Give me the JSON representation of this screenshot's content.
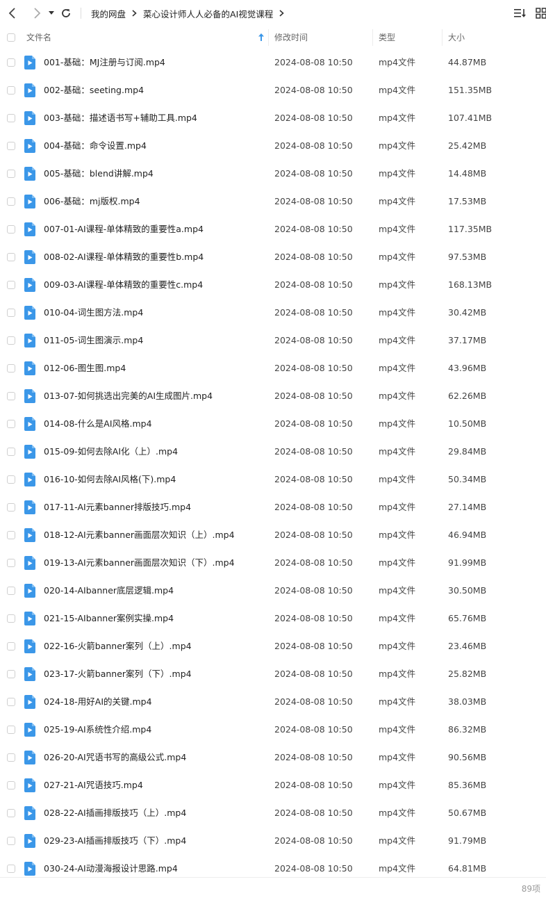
{
  "toolbar": {
    "back_icon": "chevron-left-icon",
    "forward_icon": "chevron-right-icon",
    "history_icon": "caret-down-icon",
    "refresh_icon": "refresh-icon",
    "breadcrumb": [
      "我的网盘",
      "菜心设计师人人必备的AI视觉课程"
    ],
    "sort_icon": "sort-list-icon",
    "grid_icon": "grid-view-icon"
  },
  "table": {
    "headers": {
      "name": "文件名",
      "time": "修改时间",
      "type": "类型",
      "size": "大小"
    },
    "sort_icon": "sort-up-arrow-icon",
    "rows": [
      {
        "name": "001-基础：MJ注册与订阅.mp4",
        "time": "2024-08-08 10:50",
        "type": "mp4文件",
        "size": "44.87MB"
      },
      {
        "name": "002-基础：seeting.mp4",
        "time": "2024-08-08 10:50",
        "type": "mp4文件",
        "size": "151.35MB"
      },
      {
        "name": "003-基础：描述语书写+辅助工具.mp4",
        "time": "2024-08-08 10:50",
        "type": "mp4文件",
        "size": "107.41MB"
      },
      {
        "name": "004-基础：命令设置.mp4",
        "time": "2024-08-08 10:50",
        "type": "mp4文件",
        "size": "25.42MB"
      },
      {
        "name": "005-基础：blend讲解.mp4",
        "time": "2024-08-08 10:50",
        "type": "mp4文件",
        "size": "14.48MB"
      },
      {
        "name": "006-基础：mj版权.mp4",
        "time": "2024-08-08 10:50",
        "type": "mp4文件",
        "size": "17.53MB"
      },
      {
        "name": "007-01-AI课程-单体精致的重要性a.mp4",
        "time": "2024-08-08 10:50",
        "type": "mp4文件",
        "size": "117.35MB"
      },
      {
        "name": "008-02-AI课程-单体精致的重要性b.mp4",
        "time": "2024-08-08 10:50",
        "type": "mp4文件",
        "size": "97.53MB"
      },
      {
        "name": "009-03-AI课程-单体精致的重要性c.mp4",
        "time": "2024-08-08 10:50",
        "type": "mp4文件",
        "size": "168.13MB"
      },
      {
        "name": "010-04-词生图方法.mp4",
        "time": "2024-08-08 10:50",
        "type": "mp4文件",
        "size": "30.42MB"
      },
      {
        "name": "011-05-词生图演示.mp4",
        "time": "2024-08-08 10:50",
        "type": "mp4文件",
        "size": "37.17MB"
      },
      {
        "name": "012-06-图生图.mp4",
        "time": "2024-08-08 10:50",
        "type": "mp4文件",
        "size": "43.96MB"
      },
      {
        "name": "013-07-如何挑选出完美的AI生成图片.mp4",
        "time": "2024-08-08 10:50",
        "type": "mp4文件",
        "size": "62.26MB"
      },
      {
        "name": "014-08-什么是AI风格.mp4",
        "time": "2024-08-08 10:50",
        "type": "mp4文件",
        "size": "10.50MB"
      },
      {
        "name": "015-09-如何去除AI化（上）.mp4",
        "time": "2024-08-08 10:50",
        "type": "mp4文件",
        "size": "29.84MB"
      },
      {
        "name": "016-10-如何去除AI风格(下).mp4",
        "time": "2024-08-08 10:50",
        "type": "mp4文件",
        "size": "50.34MB"
      },
      {
        "name": "017-11-AI元素banner排版技巧.mp4",
        "time": "2024-08-08 10:50",
        "type": "mp4文件",
        "size": "27.14MB"
      },
      {
        "name": "018-12-AI元素banner画面层次知识（上）.mp4",
        "time": "2024-08-08 10:50",
        "type": "mp4文件",
        "size": "46.94MB"
      },
      {
        "name": "019-13-AI元素banner画面层次知识（下）.mp4",
        "time": "2024-08-08 10:50",
        "type": "mp4文件",
        "size": "91.99MB"
      },
      {
        "name": "020-14-AIbanner底层逻辑.mp4",
        "time": "2024-08-08 10:50",
        "type": "mp4文件",
        "size": "30.50MB"
      },
      {
        "name": "021-15-AIbanner案例实操.mp4",
        "time": "2024-08-08 10:50",
        "type": "mp4文件",
        "size": "65.76MB"
      },
      {
        "name": "022-16-火箭banner案列（上）.mp4",
        "time": "2024-08-08 10:50",
        "type": "mp4文件",
        "size": "23.46MB"
      },
      {
        "name": "023-17-火箭banner案列（下）.mp4",
        "time": "2024-08-08 10:50",
        "type": "mp4文件",
        "size": "25.82MB"
      },
      {
        "name": "024-18-用好AI的关键.mp4",
        "time": "2024-08-08 10:50",
        "type": "mp4文件",
        "size": "38.03MB"
      },
      {
        "name": "025-19-AI系统性介绍.mp4",
        "time": "2024-08-08 10:50",
        "type": "mp4文件",
        "size": "86.32MB"
      },
      {
        "name": "026-20-AI咒语书写的高级公式.mp4",
        "time": "2024-08-08 10:50",
        "type": "mp4文件",
        "size": "90.56MB"
      },
      {
        "name": "027-21-AI咒语技巧.mp4",
        "time": "2024-08-08 10:50",
        "type": "mp4文件",
        "size": "85.36MB"
      },
      {
        "name": "028-22-AI插画排版技巧（上）.mp4",
        "time": "2024-08-08 10:50",
        "type": "mp4文件",
        "size": "50.67MB"
      },
      {
        "name": "029-23-AI插画排版技巧（下）.mp4",
        "time": "2024-08-08 10:50",
        "type": "mp4文件",
        "size": "91.79MB"
      },
      {
        "name": "030-24-AI动漫海报设计思路.mp4",
        "time": "2024-08-08 10:50",
        "type": "mp4文件",
        "size": "64.81MB"
      }
    ]
  },
  "footer": {
    "count": "89项"
  },
  "colors": {
    "accent": "#3b97e8",
    "icon_dark": "#444444"
  }
}
